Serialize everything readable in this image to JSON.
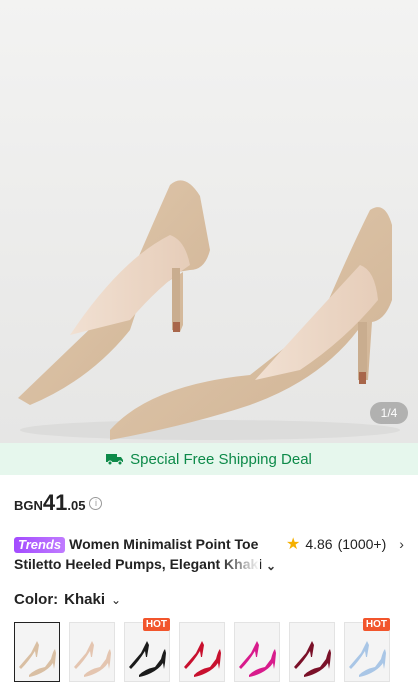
{
  "image": {
    "alt": "Khaki suede pointed-toe stiletto pumps",
    "counter": "1/4"
  },
  "shipping": {
    "label": "Special Free Shipping Deal",
    "color": "#0d8a49"
  },
  "price": {
    "currency": "BGN",
    "integer": "41",
    "decimal": ".05",
    "info_icon": "info-circle-icon"
  },
  "product": {
    "badge": "Trends",
    "title": "Women Minimalist Point Toe Stiletto Heeled Pumps, Elegant Khaki"
  },
  "rating": {
    "score": "4.86",
    "count": "(1000+)",
    "icon": "star-icon"
  },
  "color": {
    "label": "Color:",
    "value": "Khaki"
  },
  "swatches": [
    {
      "color": "#d9bfa3",
      "hot": "",
      "selected": true
    },
    {
      "color": "#e4c5b0",
      "hot": ""
    },
    {
      "color": "#1b1b1b",
      "hot": "HOT"
    },
    {
      "color": "#c8102e",
      "hot": ""
    },
    {
      "color": "#d81b8c",
      "hot": ""
    },
    {
      "color": "#7a1028",
      "hot": ""
    },
    {
      "color": "#a9c6e6",
      "hot": "HOT"
    }
  ]
}
